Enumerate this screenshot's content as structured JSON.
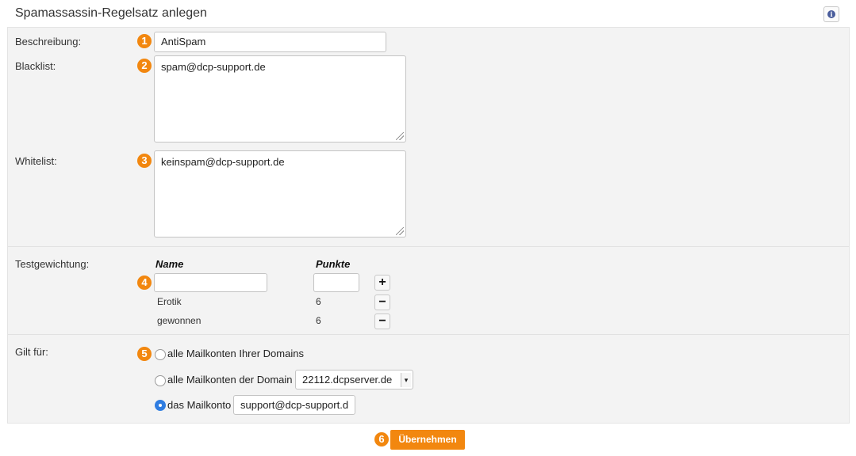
{
  "header": {
    "title": "Spamassassin-Regelsatz anlegen",
    "info_icon": "info-icon"
  },
  "form": {
    "beschreibung": {
      "label": "Beschreibung:",
      "value": "AntiSpam",
      "step": "1"
    },
    "blacklist": {
      "label": "Blacklist:",
      "value": "spam@dcp-support.de",
      "step": "2"
    },
    "whitelist": {
      "label": "Whitelist:",
      "value": "keinspam@dcp-support.de",
      "step": "3"
    },
    "testgewichtung": {
      "label": "Testgewichtung:",
      "step": "4",
      "col_name": "Name",
      "col_punkte": "Punkte",
      "new_name": "",
      "new_punkte": "",
      "add_label": "+",
      "rows": [
        {
          "name": "Erotik",
          "punkte": "6",
          "remove_label": "−"
        },
        {
          "name": "gewonnen",
          "punkte": "6",
          "remove_label": "−"
        }
      ]
    },
    "gilt_fuer": {
      "label": "Gilt für:",
      "step": "5",
      "option_all": "alle Mailkonten Ihrer Domains",
      "option_domain": "alle Mailkonten der Domain",
      "domain_selected": "22112.dcpserver.de",
      "option_account": "das Mailkonto",
      "account_value": "support@dcp-support.d",
      "selected": "account"
    }
  },
  "submit": {
    "step": "6",
    "label": "Übernehmen"
  },
  "colors": {
    "accent": "#f2870f",
    "radio_checked": "#2f7de1"
  }
}
